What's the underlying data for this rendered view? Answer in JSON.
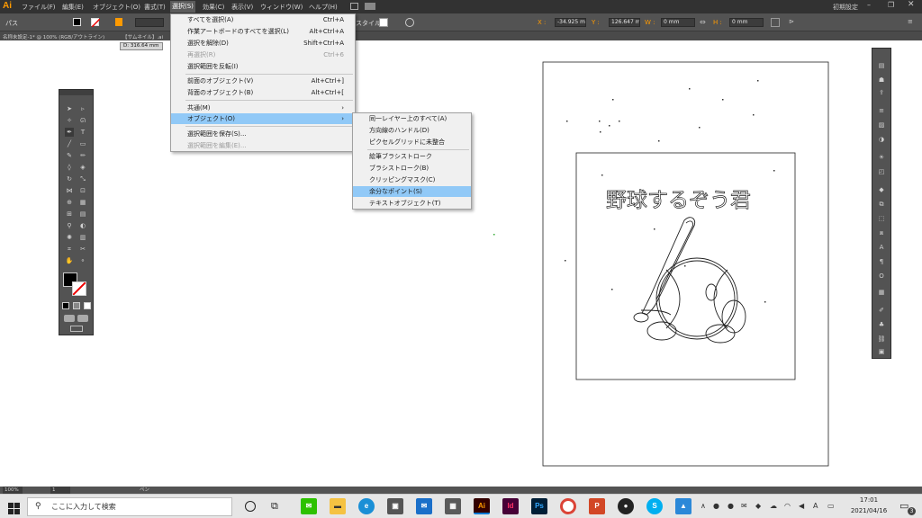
{
  "app": {
    "logo": "Ai",
    "menus": [
      "ファイル(F)",
      "編集(E)",
      "オブジェクト(O)",
      "書式(T)",
      "選択(S)",
      "効果(C)",
      "表示(V)",
      "ウィンドウ(W)",
      "ヘルプ(H)"
    ],
    "workspace": "初期設定"
  },
  "control_bar": {
    "path_label": "パス",
    "style_label": "スタイル :",
    "x_label": "X :",
    "x_value": "-34.925 m",
    "y_label": "Y :",
    "y_value": "126.647 m",
    "w_label": "W :",
    "w_value": "0 mm",
    "h_label": "H :",
    "h_value": "0 mm"
  },
  "document_tabs": {
    "tab1": "名称未設定-1* @ 100% (RGB/アウトライン)",
    "tab2": "【サムネイル】.ai"
  },
  "tooltip": "D: 316.64 mm",
  "select_menu": {
    "items": [
      {
        "label": "すべてを選択(A)",
        "shortcut": "Ctrl+A",
        "disabled": false
      },
      {
        "label": "作業アートボードのすべてを選択(L)",
        "shortcut": "Alt+Ctrl+A",
        "disabled": false
      },
      {
        "label": "選択を解除(D)",
        "shortcut": "Shift+Ctrl+A",
        "disabled": false
      },
      {
        "label": "再選択(R)",
        "shortcut": "Ctrl+6",
        "disabled": true
      },
      {
        "label": "選択範囲を反転(I)",
        "shortcut": "",
        "disabled": false
      },
      {
        "label": "前面のオブジェクト(V)",
        "shortcut": "Alt+Ctrl+]",
        "disabled": false
      },
      {
        "label": "背面のオブジェクト(B)",
        "shortcut": "Alt+Ctrl+[",
        "disabled": false
      },
      {
        "label": "共通(M)",
        "shortcut": "",
        "disabled": false
      },
      {
        "label": "オブジェクト(O)",
        "shortcut": "",
        "disabled": false
      },
      {
        "label": "選択範囲を保存(S)...",
        "shortcut": "",
        "disabled": false
      },
      {
        "label": "選択範囲を編集(E)...",
        "shortcut": "",
        "disabled": true
      }
    ]
  },
  "object_submenu": {
    "items": [
      {
        "label": "同一レイヤー上のすべて(A)"
      },
      {
        "label": "方向線のハンドル(D)"
      },
      {
        "label": "ピクセルグリッドに未整合"
      },
      {
        "label": "絵筆ブラシストローク"
      },
      {
        "label": "ブラシストローク(B)"
      },
      {
        "label": "クリッピングマスク(C)"
      },
      {
        "label": "余分なポイント(S)"
      },
      {
        "label": "テキストオブジェクト(T)"
      }
    ],
    "highlighted": "余分なポイント(S)"
  },
  "artwork": {
    "title_text": "野球するぞう君"
  },
  "status_bar": {
    "zoom": "100%",
    "page": "1",
    "tool_name": "ペン"
  },
  "taskbar": {
    "search_placeholder": "ここに入力して検索",
    "time": "17:01",
    "date": "2021/04/16",
    "ime": "A",
    "notification_count": "3"
  },
  "colors": {
    "ui_dark": "#323232",
    "panel": "#535353",
    "highlight": "#91c9f7",
    "ai_orange": "#ff9a00"
  }
}
